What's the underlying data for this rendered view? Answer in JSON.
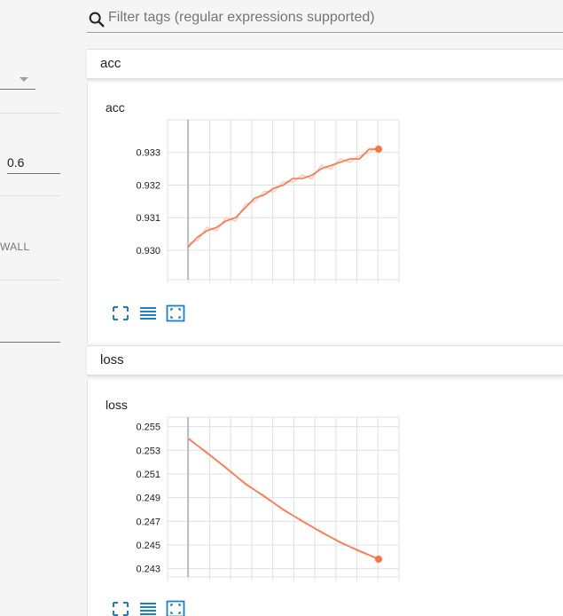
{
  "search": {
    "placeholder": "Filter tags (regular expressions supported)"
  },
  "sidebar": {
    "smoothing_value": "0.6",
    "wall_label": "WALL"
  },
  "categories": [
    {
      "name": "acc",
      "card_title": "acc"
    },
    {
      "name": "loss",
      "card_title": "loss"
    }
  ],
  "colors": {
    "series": "#ff7043",
    "series_raw": "#ffccbc",
    "accent_blue": "#1a7fc6",
    "grid": "#e0e0e0"
  },
  "icons": {
    "search": "search-icon",
    "expand": "fullscreen-icon",
    "log": "toggle-log-scale-icon",
    "fit": "fit-domain-icon"
  },
  "chart_data": [
    {
      "type": "line",
      "title": "acc",
      "yticks": [
        "0.930",
        "0.931",
        "0.932",
        "0.933"
      ],
      "ylim": [
        0.9291,
        0.934
      ],
      "xlim": [
        0,
        1
      ],
      "grid": true,
      "series": [
        {
          "x": [
            0.0,
            0.05,
            0.1,
            0.15,
            0.2,
            0.25,
            0.3,
            0.35,
            0.4,
            0.45,
            0.5,
            0.55,
            0.6,
            0.65,
            0.7,
            0.75,
            0.8,
            0.85,
            0.9,
            0.95,
            1.0
          ],
          "y": [
            0.9301,
            0.9304,
            0.9306,
            0.9307,
            0.9309,
            0.931,
            0.9313,
            0.9316,
            0.9317,
            0.9319,
            0.932,
            0.9322,
            0.9322,
            0.9323,
            0.9325,
            0.9326,
            0.9327,
            0.9328,
            0.9328,
            0.9331,
            0.9331
          ]
        }
      ]
    },
    {
      "type": "line",
      "title": "loss",
      "yticks": [
        "0.255",
        "0.253",
        "0.251",
        "0.249",
        "0.247",
        "0.245",
        "0.243"
      ],
      "ylim": [
        0.2423,
        0.2558
      ],
      "xlim": [
        0,
        1
      ],
      "grid": true,
      "series": [
        {
          "x": [
            0.0,
            0.1,
            0.2,
            0.3,
            0.4,
            0.5,
            0.6,
            0.7,
            0.8,
            0.9,
            1.0
          ],
          "y": [
            0.254,
            0.2528,
            0.2515,
            0.2502,
            0.2491,
            0.248,
            0.247,
            0.2461,
            0.2452,
            0.2445,
            0.2438
          ]
        }
      ]
    }
  ]
}
